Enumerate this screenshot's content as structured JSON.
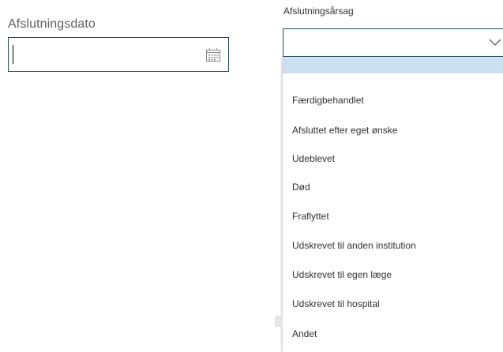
{
  "end_date": {
    "label": "Afslutningsdato",
    "value": "",
    "icon": "calendar-icon"
  },
  "end_reason": {
    "label": "Afslutningsårsag",
    "selected": "",
    "icon": "chevron-down-icon",
    "options": [
      "",
      "Færdigbehandlet",
      "Afsluttet efter eget ønske",
      "Udeblevet",
      "Død",
      "Fraflyttet",
      "Udskrevet til anden institution",
      "Udskrevet til egen læge",
      "Udskrevet til hospital",
      "Andet"
    ]
  },
  "colors": {
    "field_border": "#1f4e5a",
    "selected_option": "#ccdff0"
  }
}
